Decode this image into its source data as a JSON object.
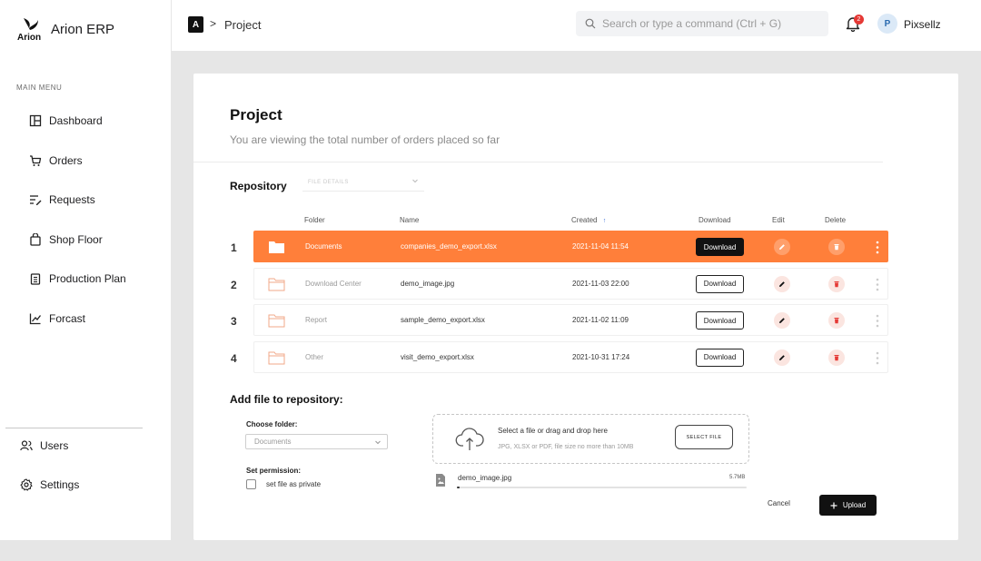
{
  "app": {
    "logo_text": "Arion",
    "name": "Arion ERP"
  },
  "sidebar": {
    "menu_label": "MAIN MENU",
    "items": [
      {
        "label": "Dashboard",
        "icon": "dashboard-icon"
      },
      {
        "label": "Orders",
        "icon": "cart-icon"
      },
      {
        "label": "Requests",
        "icon": "requests-icon"
      },
      {
        "label": "Shop Floor",
        "icon": "shop-floor-icon"
      },
      {
        "label": "Production Plan",
        "icon": "clipboard-icon"
      },
      {
        "label": "Forcast",
        "icon": "trend-chart-icon"
      }
    ],
    "bottom_items": [
      {
        "label": "Users",
        "icon": "users-icon"
      },
      {
        "label": "Settings",
        "icon": "gear-icon"
      }
    ]
  },
  "topbar": {
    "breadcrumb_badge": "A",
    "breadcrumb_separator": ">",
    "breadcrumb_title": "Project",
    "search_placeholder": "Search or type a command (Ctrl + G)",
    "notification_count": "2",
    "user_initial": "P",
    "user_name": "Pixsellz"
  },
  "page": {
    "title": "Project",
    "subtitle": "You are viewing the total number of orders placed so far"
  },
  "repository": {
    "title": "Repository",
    "filter_placeholder": "FILE DETAILS",
    "columns": {
      "folder": "Folder",
      "name": "Name",
      "created": "Created",
      "download": "Download",
      "edit": "Edit",
      "delete": "Delete"
    },
    "sort_indicator": "↑",
    "rows": [
      {
        "num": "1",
        "folder": "Documents",
        "name": "companies_demo_export.xlsx",
        "created": "2021-11-04  11:54",
        "download_label": "Download",
        "active": true
      },
      {
        "num": "2",
        "folder": "Download Center",
        "name": "demo_image.jpg",
        "created": "2021-11-03  22:00",
        "download_label": "Download",
        "active": false
      },
      {
        "num": "3",
        "folder": "Report",
        "name": "sample_demo_export.xlsx",
        "created": "2021-11-02  11:09",
        "download_label": "Download",
        "active": false
      },
      {
        "num": "4",
        "folder": "Other",
        "name": "visit_demo_export.xlsx",
        "created": "2021-10-31  17:24",
        "download_label": "Download",
        "active": false
      }
    ]
  },
  "add_file": {
    "title": "Add file to repository:",
    "choose_folder_label": "Choose folder:",
    "folder_value": "Documents",
    "permission_label": "Set permission:",
    "private_label": "set file as private",
    "private_checked": false,
    "dropzone_title": "Select a file or drag and drop here",
    "dropzone_hint": "JPG, XLSX or PDF, file size no more than 10MB",
    "select_file_label": "SELECT FILE",
    "upload_file_name": "demo_image.jpg",
    "upload_file_size": "5.7MB",
    "upload_progress": 0.01,
    "cancel_label": "Cancel",
    "upload_label": "Upload"
  },
  "colors": {
    "accent": "#ff7f3a",
    "dark": "#111111",
    "delete_red": "#e53935"
  }
}
